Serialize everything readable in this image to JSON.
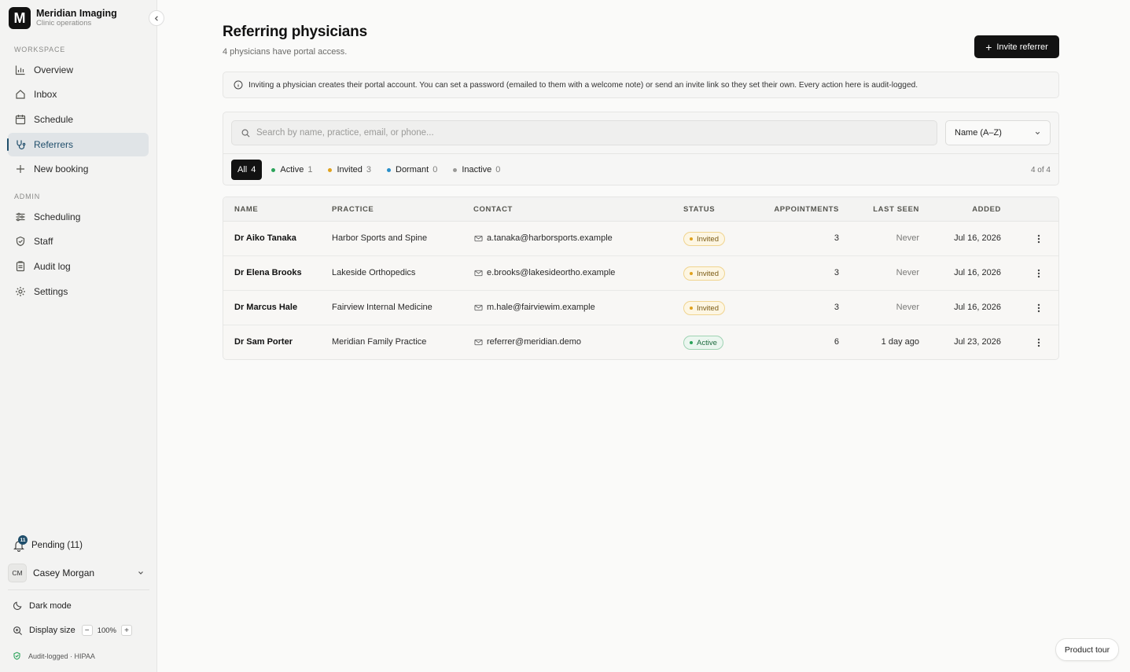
{
  "brand": {
    "initial": "M",
    "name": "Meridian Imaging",
    "subtitle": "Clinic operations"
  },
  "sidebar": {
    "workspace_label": "WORKSPACE",
    "workspace_items": [
      {
        "label": "Overview",
        "icon": "bar-chart-icon"
      },
      {
        "label": "Inbox",
        "icon": "home-icon"
      },
      {
        "label": "Schedule",
        "icon": "calendar-icon"
      },
      {
        "label": "Referrers",
        "icon": "stethoscope-icon",
        "active": true
      },
      {
        "label": "New booking",
        "icon": "plus-icon"
      }
    ],
    "admin_label": "ADMIN",
    "admin_items": [
      {
        "label": "Scheduling",
        "icon": "sliders-icon"
      },
      {
        "label": "Staff",
        "icon": "shield-icon"
      },
      {
        "label": "Audit log",
        "icon": "clipboard-icon"
      },
      {
        "label": "Settings",
        "icon": "gear-icon"
      }
    ],
    "pending": {
      "label": "Pending (11)",
      "badge": "11"
    },
    "user": {
      "initials": "CM",
      "name": "Casey Morgan"
    },
    "dark_mode_label": "Dark mode",
    "display_size": {
      "label": "Display size",
      "value": "100%",
      "minus": "−",
      "plus": "+"
    },
    "compliance_label": "Audit-logged · HIPAA"
  },
  "header": {
    "title": "Referring physicians",
    "subtitle": "4 physicians have portal access.",
    "invite_label": "Invite referrer",
    "invite_plus": "+"
  },
  "notice": {
    "text": "Inviting a physician creates their portal account. You can set a password (emailed to them with a welcome note) or send an invite link so they set their own. Every action here is audit-logged."
  },
  "filters": {
    "search_placeholder": "Search by name, practice, email, or phone...",
    "sort_value": "Name (A–Z)",
    "tabs": [
      {
        "label": "All",
        "count": "4",
        "active": true,
        "dot": ""
      },
      {
        "label": "Active",
        "count": "1",
        "dot": "#2ba35a"
      },
      {
        "label": "Invited",
        "count": "3",
        "dot": "#e0a21e"
      },
      {
        "label": "Dormant",
        "count": "0",
        "dot": "#2a8fc9"
      },
      {
        "label": "Inactive",
        "count": "0",
        "dot": "#9a9a98"
      }
    ],
    "result_count": "4 of 4"
  },
  "table": {
    "columns": [
      "NAME",
      "PRACTICE",
      "CONTACT",
      "STATUS",
      "APPOINTMENTS",
      "LAST SEEN",
      "ADDED"
    ],
    "rows": [
      {
        "name": "Dr Aiko Tanaka",
        "practice": "Harbor Sports and Spine",
        "email": "a.tanaka@harborsports.example",
        "status": "Invited",
        "appointments": "3",
        "last_seen": "Never",
        "added": "Jul 16, 2026"
      },
      {
        "name": "Dr Elena Brooks",
        "practice": "Lakeside Orthopedics",
        "email": "e.brooks@lakesideortho.example",
        "status": "Invited",
        "appointments": "3",
        "last_seen": "Never",
        "added": "Jul 16, 2026"
      },
      {
        "name": "Dr Marcus Hale",
        "practice": "Fairview Internal Medicine",
        "email": "m.hale@fairviewim.example",
        "status": "Invited",
        "appointments": "3",
        "last_seen": "Never",
        "added": "Jul 16, 2026"
      },
      {
        "name": "Dr Sam Porter",
        "practice": "Meridian Family Practice",
        "email": "referrer@meridian.demo",
        "status": "Active",
        "appointments": "6",
        "last_seen": "1 day ago",
        "added": "Jul 23, 2026"
      }
    ]
  },
  "tour_label": "Product tour",
  "colors": {
    "accent": "#1f4e6b",
    "primary_button": "#121212",
    "invited": "#e0a21e",
    "active": "#2ba35a"
  }
}
